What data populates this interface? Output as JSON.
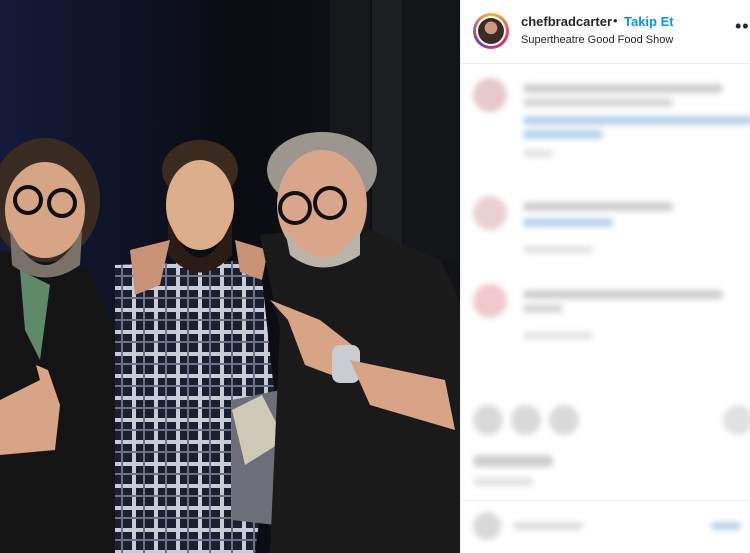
{
  "post": {
    "username": "chefbradcarter",
    "separator": "•",
    "follow_label": "Takip Et",
    "location": "Supertheatre Good Food Show",
    "more_label": "•••"
  },
  "icons": {
    "avatar": "user-avatar",
    "more": "more-options-icon",
    "like": "heart-icon",
    "comment": "comment-icon",
    "share": "share-icon",
    "save": "bookmark-icon"
  },
  "colors": {
    "follow": "#0095f6",
    "text": "#262626",
    "border": "#efefef"
  }
}
